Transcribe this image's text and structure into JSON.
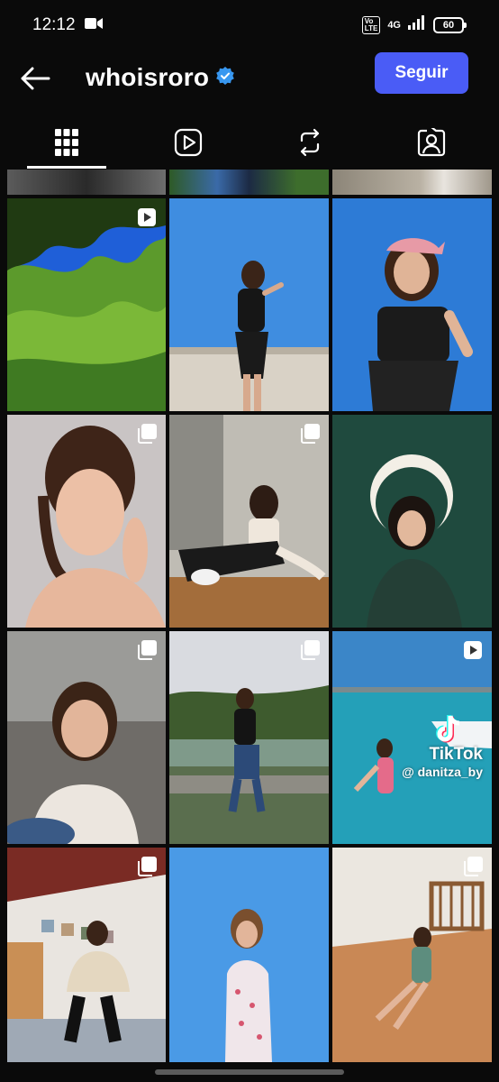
{
  "status_bar": {
    "time": "12:12",
    "volte_label": "Vo\nLTE",
    "network": "4G",
    "battery": "60"
  },
  "header": {
    "username": "whoisroro",
    "verified": true,
    "follow_label": "Seguir"
  },
  "tabs": [
    {
      "icon": "grid-icon",
      "active": true
    },
    {
      "icon": "reels-icon",
      "active": false
    },
    {
      "icon": "reposts-icon",
      "active": false
    },
    {
      "icon": "tagged-icon",
      "active": false
    }
  ],
  "grid": {
    "top_partial_row": [
      "photo",
      "photo",
      "photo"
    ],
    "rows": [
      [
        {
          "badge": "reel-icon",
          "scene": "tree canopy against blue sky"
        },
        {
          "badge": "",
          "scene": "woman in black on rooftop"
        },
        {
          "badge": "",
          "scene": "woman with pink bandana"
        }
      ],
      [
        {
          "badge": "carousel-icon",
          "scene": "close-up portrait"
        },
        {
          "badge": "carousel-icon",
          "scene": "sitting in bathroom"
        },
        {
          "badge": "",
          "scene": "portrait with halo on green wall"
        }
      ],
      [
        {
          "badge": "carousel-icon",
          "scene": "selfie with glasses"
        },
        {
          "badge": "carousel-icon",
          "scene": "sitting on lakeside wall"
        },
        {
          "badge": "reel-icon",
          "scene": "wading at beach",
          "watermark": {
            "brand": "TikTok",
            "user": "@ danitza_by"
          }
        }
      ],
      [
        {
          "badge": "carousel-icon",
          "scene": "sitting in bedroom"
        },
        {
          "badge": "",
          "scene": "swimsuit against blue sky"
        },
        {
          "badge": "carousel-icon",
          "scene": "sitting on terrace floor"
        }
      ]
    ]
  },
  "colors": {
    "background": "#0a0a0a",
    "follow_button": "#4a5cf6",
    "verified_badge": "#3897f0"
  }
}
